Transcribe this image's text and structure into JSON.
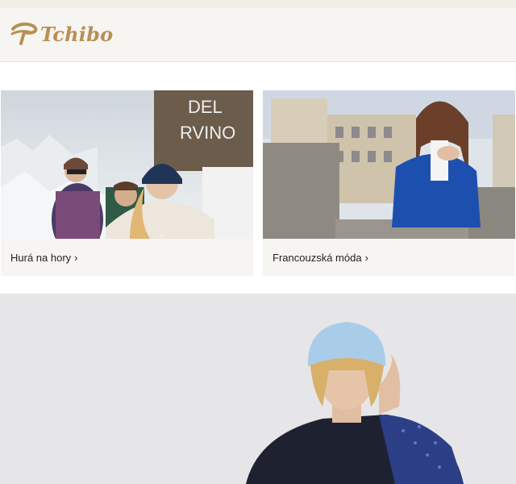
{
  "header": {
    "logo_text": "Tchibo",
    "logo_color": "#b88f55",
    "background": "#f7f5f1"
  },
  "cards": [
    {
      "label": "Hurá na hory",
      "chevron": "›",
      "image": "winter-mountain-group-photo"
    },
    {
      "label": "Francouzská móda",
      "chevron": "›",
      "image": "paris-woman-blue-cardigan-photo"
    }
  ],
  "hero": {
    "image": "woman-blue-knit-beanie-photo"
  }
}
